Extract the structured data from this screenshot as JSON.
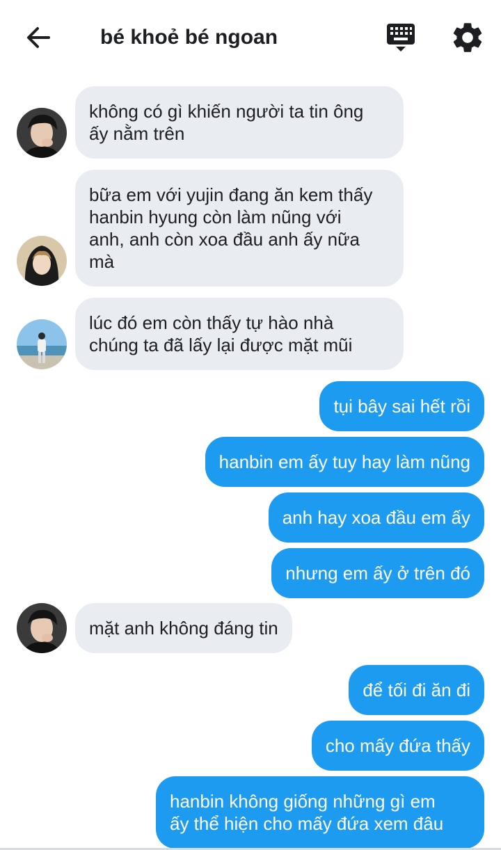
{
  "header": {
    "title": "bé khoẻ bé ngoan",
    "back_icon": "arrow-left-icon",
    "keyboard_icon": "keyboard-icon",
    "settings_icon": "gear-icon"
  },
  "colors": {
    "sent_bubble": "#1d9bf0",
    "received_bubble": "#e9ecf0",
    "text_dark": "#1c1e21"
  },
  "messages": [
    {
      "side": "received",
      "avatar": "user-a",
      "text": "không có gì khiến người ta tin ông\nấy nằm trên"
    },
    {
      "side": "received",
      "avatar": "user-b",
      "text": "bữa em với yujin đang ăn kem thấy\nhanbin hyung còn làm nũng với\nanh, anh còn xoa đầu anh ấy nữa\nmà"
    },
    {
      "side": "received",
      "avatar": "user-c",
      "text": "lúc đó em còn thấy tự hào nhà\nchúng ta đã lấy lại được mặt mũi"
    },
    {
      "side": "sent",
      "text": "tụi bây sai hết rồi"
    },
    {
      "side": "sent",
      "text": "hanbin em ấy tuy hay làm nũng"
    },
    {
      "side": "sent",
      "text": "anh hay xoa đầu em ấy"
    },
    {
      "side": "sent",
      "text": "nhưng em ấy ở trên đó"
    },
    {
      "side": "received",
      "avatar": "user-a",
      "text": "mặt anh không đáng tin"
    },
    {
      "side": "sent",
      "text": "để tối đi ăn đi"
    },
    {
      "side": "sent",
      "text": "cho mấy đứa thấy"
    },
    {
      "side": "sent",
      "text": "hanbin không giống những gì em\nấy thể hiện cho mấy đứa xem đâu"
    }
  ]
}
